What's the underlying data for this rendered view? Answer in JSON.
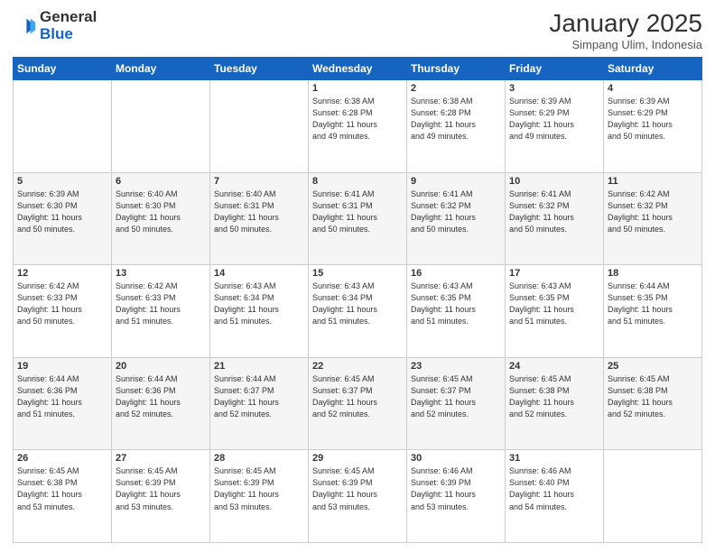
{
  "header": {
    "logo_general": "General",
    "logo_blue": "Blue",
    "month_title": "January 2025",
    "subtitle": "Simpang Ulim, Indonesia"
  },
  "days_of_week": [
    "Sunday",
    "Monday",
    "Tuesday",
    "Wednesday",
    "Thursday",
    "Friday",
    "Saturday"
  ],
  "weeks": [
    [
      {
        "day": "",
        "info": ""
      },
      {
        "day": "",
        "info": ""
      },
      {
        "day": "",
        "info": ""
      },
      {
        "day": "1",
        "info": "Sunrise: 6:38 AM\nSunset: 6:28 PM\nDaylight: 11 hours\nand 49 minutes."
      },
      {
        "day": "2",
        "info": "Sunrise: 6:38 AM\nSunset: 6:28 PM\nDaylight: 11 hours\nand 49 minutes."
      },
      {
        "day": "3",
        "info": "Sunrise: 6:39 AM\nSunset: 6:29 PM\nDaylight: 11 hours\nand 49 minutes."
      },
      {
        "day": "4",
        "info": "Sunrise: 6:39 AM\nSunset: 6:29 PM\nDaylight: 11 hours\nand 50 minutes."
      }
    ],
    [
      {
        "day": "5",
        "info": "Sunrise: 6:39 AM\nSunset: 6:30 PM\nDaylight: 11 hours\nand 50 minutes."
      },
      {
        "day": "6",
        "info": "Sunrise: 6:40 AM\nSunset: 6:30 PM\nDaylight: 11 hours\nand 50 minutes."
      },
      {
        "day": "7",
        "info": "Sunrise: 6:40 AM\nSunset: 6:31 PM\nDaylight: 11 hours\nand 50 minutes."
      },
      {
        "day": "8",
        "info": "Sunrise: 6:41 AM\nSunset: 6:31 PM\nDaylight: 11 hours\nand 50 minutes."
      },
      {
        "day": "9",
        "info": "Sunrise: 6:41 AM\nSunset: 6:32 PM\nDaylight: 11 hours\nand 50 minutes."
      },
      {
        "day": "10",
        "info": "Sunrise: 6:41 AM\nSunset: 6:32 PM\nDaylight: 11 hours\nand 50 minutes."
      },
      {
        "day": "11",
        "info": "Sunrise: 6:42 AM\nSunset: 6:32 PM\nDaylight: 11 hours\nand 50 minutes."
      }
    ],
    [
      {
        "day": "12",
        "info": "Sunrise: 6:42 AM\nSunset: 6:33 PM\nDaylight: 11 hours\nand 50 minutes."
      },
      {
        "day": "13",
        "info": "Sunrise: 6:42 AM\nSunset: 6:33 PM\nDaylight: 11 hours\nand 51 minutes."
      },
      {
        "day": "14",
        "info": "Sunrise: 6:43 AM\nSunset: 6:34 PM\nDaylight: 11 hours\nand 51 minutes."
      },
      {
        "day": "15",
        "info": "Sunrise: 6:43 AM\nSunset: 6:34 PM\nDaylight: 11 hours\nand 51 minutes."
      },
      {
        "day": "16",
        "info": "Sunrise: 6:43 AM\nSunset: 6:35 PM\nDaylight: 11 hours\nand 51 minutes."
      },
      {
        "day": "17",
        "info": "Sunrise: 6:43 AM\nSunset: 6:35 PM\nDaylight: 11 hours\nand 51 minutes."
      },
      {
        "day": "18",
        "info": "Sunrise: 6:44 AM\nSunset: 6:35 PM\nDaylight: 11 hours\nand 51 minutes."
      }
    ],
    [
      {
        "day": "19",
        "info": "Sunrise: 6:44 AM\nSunset: 6:36 PM\nDaylight: 11 hours\nand 51 minutes."
      },
      {
        "day": "20",
        "info": "Sunrise: 6:44 AM\nSunset: 6:36 PM\nDaylight: 11 hours\nand 52 minutes."
      },
      {
        "day": "21",
        "info": "Sunrise: 6:44 AM\nSunset: 6:37 PM\nDaylight: 11 hours\nand 52 minutes."
      },
      {
        "day": "22",
        "info": "Sunrise: 6:45 AM\nSunset: 6:37 PM\nDaylight: 11 hours\nand 52 minutes."
      },
      {
        "day": "23",
        "info": "Sunrise: 6:45 AM\nSunset: 6:37 PM\nDaylight: 11 hours\nand 52 minutes."
      },
      {
        "day": "24",
        "info": "Sunrise: 6:45 AM\nSunset: 6:38 PM\nDaylight: 11 hours\nand 52 minutes."
      },
      {
        "day": "25",
        "info": "Sunrise: 6:45 AM\nSunset: 6:38 PM\nDaylight: 11 hours\nand 52 minutes."
      }
    ],
    [
      {
        "day": "26",
        "info": "Sunrise: 6:45 AM\nSunset: 6:38 PM\nDaylight: 11 hours\nand 53 minutes."
      },
      {
        "day": "27",
        "info": "Sunrise: 6:45 AM\nSunset: 6:39 PM\nDaylight: 11 hours\nand 53 minutes."
      },
      {
        "day": "28",
        "info": "Sunrise: 6:45 AM\nSunset: 6:39 PM\nDaylight: 11 hours\nand 53 minutes."
      },
      {
        "day": "29",
        "info": "Sunrise: 6:45 AM\nSunset: 6:39 PM\nDaylight: 11 hours\nand 53 minutes."
      },
      {
        "day": "30",
        "info": "Sunrise: 6:46 AM\nSunset: 6:39 PM\nDaylight: 11 hours\nand 53 minutes."
      },
      {
        "day": "31",
        "info": "Sunrise: 6:46 AM\nSunset: 6:40 PM\nDaylight: 11 hours\nand 54 minutes."
      },
      {
        "day": "",
        "info": ""
      }
    ]
  ]
}
